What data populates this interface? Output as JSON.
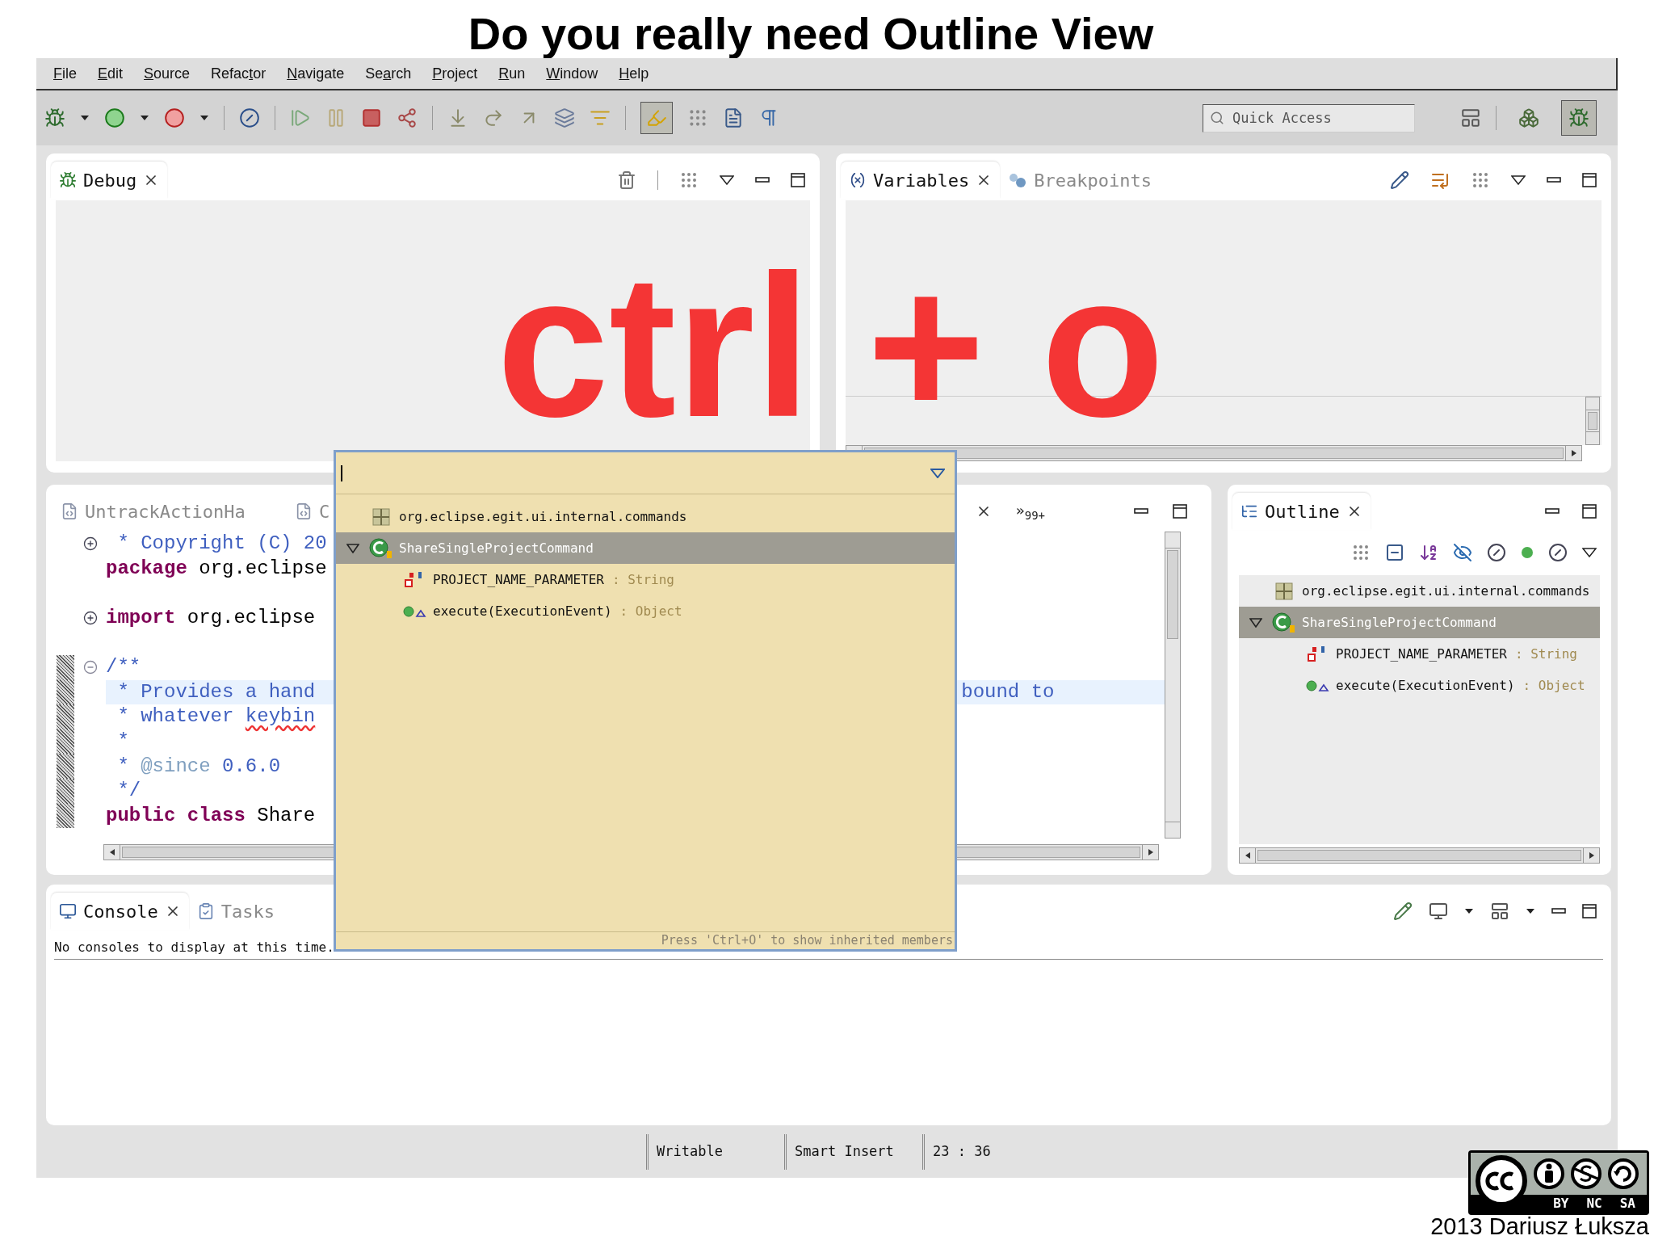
{
  "slide": {
    "title": "Do you really need Outline View",
    "overlay_caption": "ctrl + o",
    "credit": "2013 Dariusz Łuksza",
    "license_labels": [
      "BY",
      "NC",
      "SA"
    ]
  },
  "menu_bar": [
    {
      "key": "F",
      "post": "ile"
    },
    {
      "key": "E",
      "post": "dit"
    },
    {
      "key": "S",
      "post": "ource"
    },
    {
      "pre": "Refac",
      "key": "t",
      "post": "or"
    },
    {
      "key": "N",
      "post": "avigate"
    },
    {
      "pre": "Se",
      "key": "a",
      "post": "rch"
    },
    {
      "key": "P",
      "post": "roject"
    },
    {
      "key": "R",
      "post": "un"
    },
    {
      "key": "W",
      "post": "indow"
    },
    {
      "key": "H",
      "post": "elp"
    }
  ],
  "toolbar": {
    "highlight_pressed": true
  },
  "quick_access": {
    "placeholder": "Quick Access"
  },
  "perspectives": [
    {
      "selected": false
    },
    {
      "selected": true
    }
  ],
  "debug_view": {
    "tabs": [
      {
        "label": "Debug",
        "selected": true
      }
    ]
  },
  "variables_view": {
    "tabs": [
      {
        "label": "Variables",
        "selected": true
      },
      {
        "label": "Breakpoints",
        "selected": false
      }
    ]
  },
  "editor": {
    "tabs": [
      {
        "label": "UntrackActionHa",
        "selected": false
      },
      {
        "label": "C",
        "selected": false
      }
    ],
    "overflow_mark": "»",
    "overflow_count": "99+",
    "lines": [
      {
        "foldable": true,
        "collapsed": true,
        "changed": false,
        "current": false,
        "gap_before": false,
        "segments": [
          {
            "kind": "comment",
            "text": " * Copyright (C) 20"
          }
        ]
      },
      {
        "foldable": false,
        "changed": false,
        "current": false,
        "gap_before": false,
        "segments": [
          {
            "kind": "keyword",
            "text": "package"
          },
          {
            "kind": "plain",
            "text": " org.eclipse"
          }
        ]
      },
      {
        "foldable": true,
        "collapsed": true,
        "changed": false,
        "current": false,
        "gap_before": true,
        "segments": [
          {
            "kind": "keyword",
            "text": "import"
          },
          {
            "kind": "plain",
            "text": " org.eclipse"
          }
        ]
      },
      {
        "foldable": true,
        "collapsed": false,
        "changed": true,
        "current": false,
        "gap_before": true,
        "segments": [
          {
            "kind": "comment",
            "text": "/**"
          }
        ]
      },
      {
        "foldable": false,
        "changed": true,
        "current": true,
        "gap_before": false,
        "segments": [
          {
            "kind": "comment",
            "text": " * Provides a hand"
          }
        ],
        "tail": "bound to"
      },
      {
        "foldable": false,
        "changed": true,
        "current": false,
        "gap_before": false,
        "segments": [
          {
            "kind": "comment",
            "text": " * whatever "
          },
          {
            "kind": "misspelled",
            "text": "keybin"
          }
        ]
      },
      {
        "foldable": false,
        "changed": true,
        "current": false,
        "gap_before": false,
        "segments": [
          {
            "kind": "comment",
            "text": " *"
          }
        ]
      },
      {
        "foldable": false,
        "changed": true,
        "current": false,
        "gap_before": false,
        "segments": [
          {
            "kind": "comment",
            "text": " * "
          },
          {
            "kind": "doctag",
            "text": "@since"
          },
          {
            "kind": "comment",
            "text": " 0.6.0"
          }
        ]
      },
      {
        "foldable": false,
        "changed": true,
        "current": false,
        "gap_before": false,
        "segments": [
          {
            "kind": "comment",
            "text": " */"
          }
        ]
      },
      {
        "foldable": false,
        "changed": true,
        "current": false,
        "gap_before": false,
        "segments": [
          {
            "kind": "keyword",
            "text": "public"
          },
          {
            "kind": "keyword",
            "text": " class"
          },
          {
            "kind": "plain",
            "text": " Share"
          }
        ]
      }
    ]
  },
  "outline_view": {
    "tabs": [
      {
        "label": "Outline",
        "selected": true
      }
    ],
    "tree": [
      {
        "kind": "package",
        "name": "org.eclipse.egit.ui.internal.commands",
        "selected": false
      },
      {
        "kind": "class",
        "name": "ShareSingleProjectCommand",
        "selected": true,
        "expanded": true,
        "children": [
          {
            "kind": "field",
            "name": "PROJECT_NAME_PARAMETER",
            "type": ": String",
            "selected": false
          },
          {
            "kind": "method",
            "name": "execute(ExecutionEvent)",
            "type": ": Object",
            "selected": false
          }
        ]
      }
    ]
  },
  "console_view": {
    "tabs": [
      {
        "label": "Console",
        "selected": true
      },
      {
        "label": "Tasks",
        "selected": false
      }
    ],
    "message": "No consoles to display at this time."
  },
  "quick_outline": {
    "tree": [
      {
        "kind": "package",
        "name": "org.eclipse.egit.ui.internal.commands",
        "selected": false
      },
      {
        "kind": "class",
        "name": "ShareSingleProjectCommand",
        "selected": true,
        "expanded": true,
        "children": [
          {
            "kind": "field",
            "name": "PROJECT_NAME_PARAMETER",
            "type": ": String",
            "selected": false
          },
          {
            "kind": "method",
            "name": "execute(ExecutionEvent)",
            "type": ": Object",
            "selected": false
          }
        ]
      }
    ],
    "hint": "Press 'Ctrl+O' to show inherited members"
  },
  "status_bar": [
    "Writable",
    "Smart Insert",
    "23 : 36"
  ]
}
